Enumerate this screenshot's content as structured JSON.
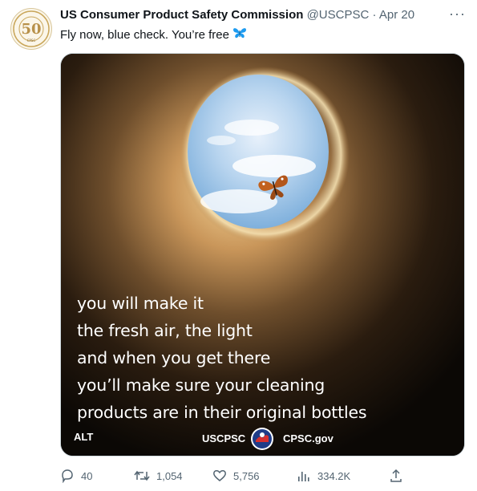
{
  "tweet": {
    "author_name": "US Consumer Product Safety Commission",
    "handle": "@USCPSC",
    "separator": "·",
    "date": "Apr 20",
    "more_label": "···",
    "text": "Fly now, blue check. You’re free",
    "emoji_icon": "butterfly-icon",
    "avatar_icon": "cpsc-50-years-logo"
  },
  "media": {
    "caption_lines": [
      "you will make it",
      "the fresh air, the light",
      "and when you get there",
      "you’ll make sure your cleaning",
      "products are in their original bottles"
    ],
    "alt_label": "ALT",
    "footer_left": "USCPSC",
    "footer_right": "CPSC.gov"
  },
  "actions": {
    "reply_count": "40",
    "retweet_count": "1,054",
    "like_count": "5,756",
    "views_count": "334.2K"
  },
  "colors": {
    "secondary_text": "#536471",
    "butterfly_blue": "#1d9bf0",
    "border": "#cfd9de"
  }
}
